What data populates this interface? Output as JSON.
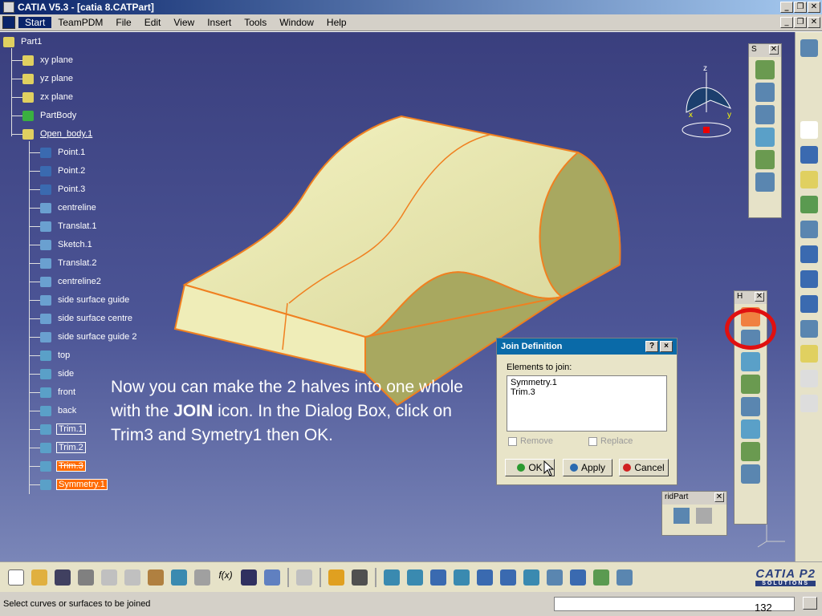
{
  "window": {
    "title": "CATIA V5.3 - [catia 8.CATPart]"
  },
  "menu": [
    "Start",
    "TeamPDM",
    "File",
    "Edit",
    "View",
    "Insert",
    "Tools",
    "Window",
    "Help"
  ],
  "tree": [
    {
      "label": "Part1",
      "level": 0
    },
    {
      "label": "xy plane",
      "level": 1
    },
    {
      "label": "yz plane",
      "level": 1
    },
    {
      "label": "zx plane",
      "level": 1
    },
    {
      "label": "PartBody",
      "level": 1
    },
    {
      "label": "Open_body.1",
      "level": 1,
      "style": "u"
    },
    {
      "label": "Point.1",
      "level": 2
    },
    {
      "label": "Point.2",
      "level": 2
    },
    {
      "label": "Point.3",
      "level": 2
    },
    {
      "label": "centreline",
      "level": 2
    },
    {
      "label": "Translat.1",
      "level": 2
    },
    {
      "label": "Sketch.1",
      "level": 2
    },
    {
      "label": "Translat.2",
      "level": 2
    },
    {
      "label": "centreline2",
      "level": 2
    },
    {
      "label": "side surface guide",
      "level": 2
    },
    {
      "label": "side surface centre",
      "level": 2
    },
    {
      "label": "side surface guide 2",
      "level": 2
    },
    {
      "label": "top",
      "level": 2
    },
    {
      "label": "side",
      "level": 2
    },
    {
      "label": "front",
      "level": 2
    },
    {
      "label": "back",
      "level": 2
    },
    {
      "label": "Trim.1",
      "level": 2,
      "style": "box"
    },
    {
      "label": "Trim.2",
      "level": 2,
      "style": "box"
    },
    {
      "label": "Trim.3",
      "level": 2,
      "style": "hl2"
    },
    {
      "label": "Symmetry.1",
      "level": 2,
      "style": "hl"
    }
  ],
  "instruction": {
    "before": "Now you can make the 2 halves into one whole with the ",
    "bold": "JOIN",
    "after": " icon. In the Dialog Box, click on Trim3 and Symetry1 then OK."
  },
  "dialog": {
    "title": "Join Definition",
    "help": "?",
    "close": "×",
    "elements_label": "Elements to join:",
    "elements": [
      "Symmetry.1",
      "Trim.3"
    ],
    "remove_label": "Remove",
    "replace_label": "Replace",
    "ok_label": "OK",
    "apply_label": "Apply",
    "cancel_label": "Cancel"
  },
  "palettes": {
    "surfaces_title": "S",
    "hybrid_title": "H",
    "hybridpart_title": "ridPart"
  },
  "compass": {
    "z": "z",
    "x": "x",
    "y": "y"
  },
  "status": {
    "message": "Select curves or surfaces to be joined",
    "page": "132"
  },
  "logo": {
    "name": "CATIA P2",
    "sub": "SOLUTIONS"
  }
}
